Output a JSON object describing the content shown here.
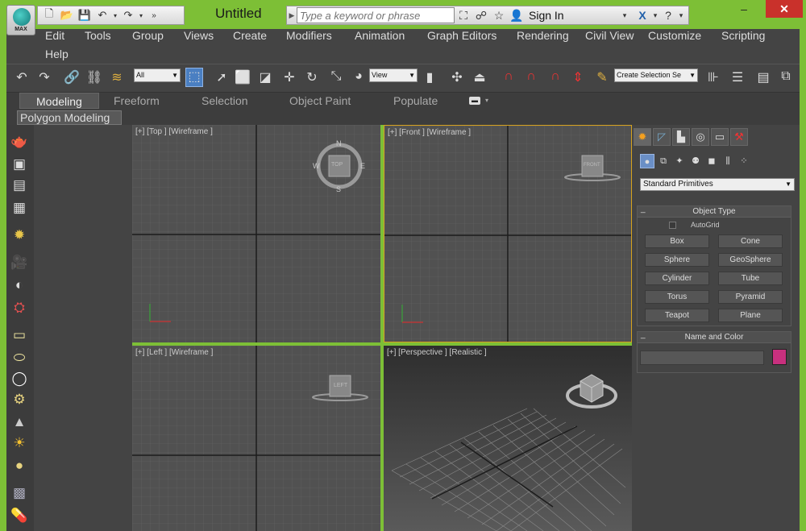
{
  "window": {
    "title": "Untitled",
    "search_placeholder": "Type a keyword or phrase",
    "signin": "Sign In",
    "app_logo_text": "MAX",
    "controls": [
      "–",
      "□",
      "✕"
    ]
  },
  "menu": [
    "Edit",
    "Tools",
    "Group",
    "Views",
    "Create",
    "Modifiers",
    "Animation",
    "Graph Editors",
    "Rendering",
    "Civil View",
    "Customize",
    "Scripting",
    "Help"
  ],
  "toolbar": {
    "filter_select": "All",
    "refcoord_select": "View",
    "selection_set": "Create Selection Se"
  },
  "ribbon_tabs": [
    "Modeling",
    "Freeform",
    "Selection",
    "Object Paint",
    "Populate"
  ],
  "ribbon_panel": "Polygon Modeling",
  "viewports": [
    {
      "label": "[+] [Top ] [Wireframe ]",
      "cube": "TOP",
      "compass": [
        "N",
        "S",
        "E",
        "W"
      ]
    },
    {
      "label": "[+] [Front ] [Wireframe ]",
      "cube": "FRONT"
    },
    {
      "label": "[+] [Left ] [Wireframe ]",
      "cube": "LEFT"
    },
    {
      "label": "[+] [Perspective ] [Realistic ]"
    }
  ],
  "command_panel": {
    "primitive_set": "Standard Primitives",
    "object_type_title": "Object Type",
    "autogrid_label": "AutoGrid",
    "primitives": [
      "Box",
      "Cone",
      "Sphere",
      "GeoSphere",
      "Cylinder",
      "Tube",
      "Torus",
      "Pyramid",
      "Teapot",
      "Plane"
    ],
    "name_color_title": "Name and Color",
    "object_color": "#c8307e"
  },
  "colors": {
    "frame": "#7dbf36",
    "active_viewport_border": "#d6a21e",
    "ui_bg": "#444444"
  }
}
